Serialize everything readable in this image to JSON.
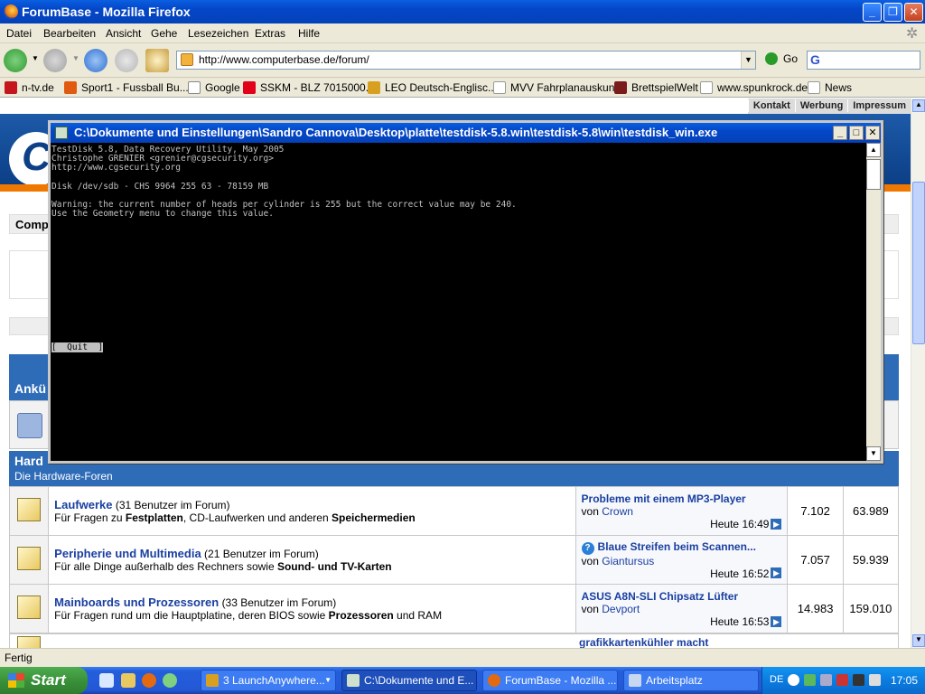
{
  "firefox": {
    "title": "ForumBase - Mozilla Firefox",
    "menu": [
      "Datei",
      "Bearbeiten",
      "Ansicht",
      "Gehe",
      "Lesezeichen",
      "Extras",
      "Hilfe"
    ],
    "url": "http://www.computerbase.de/forum/",
    "go_label": "Go",
    "bookmarks": [
      "n-tv.de",
      "Sport1 - Fussball Bu...",
      "Google",
      "SSKM - BLZ 7015000...",
      "LEO Deutsch-Englisc...",
      "MVV Fahrplanauskunft",
      "BrettspielWelt",
      "www.spunkrock.de",
      "News"
    ],
    "status": "Fertig"
  },
  "page": {
    "topnav": [
      "Kontakt",
      "Werbung",
      "Impressum"
    ],
    "comp_label": "Comp",
    "announce_section": "Ankü",
    "hardware_section": {
      "title": "Hard",
      "subtitle": "Die Hardware-Foren"
    },
    "forums": [
      {
        "name": "Laufwerke",
        "users": "(31 Benutzer im Forum)",
        "desc_prefix": "Für Fragen zu ",
        "desc_bold1": "Festplatten",
        "desc_mid": ", CD-Laufwerken und anderen ",
        "desc_bold2": "Speichermedien",
        "desc_suffix": "",
        "last_title": "Probleme mit einem MP3-Player",
        "last_by_label": "von",
        "last_by": "Crown",
        "last_date": "Heute",
        "last_time": "16:49",
        "threads": "7.102",
        "posts": "63.989"
      },
      {
        "name": "Peripherie und Multimedia",
        "users": "(21 Benutzer im Forum)",
        "desc_prefix": "Für alle Dinge außerhalb des Rechners sowie ",
        "desc_bold1": "Sound- und TV-Karten",
        "desc_mid": "",
        "desc_bold2": "",
        "desc_suffix": "",
        "last_title": "Blaue Streifen beim Scannen...",
        "last_by_label": "von",
        "last_by": "Giantursus",
        "last_date": "Heute",
        "last_time": "16:52",
        "threads": "7.057",
        "posts": "59.939"
      },
      {
        "name": "Mainboards und Prozessoren",
        "users": "(33 Benutzer im Forum)",
        "desc_prefix": "Für Fragen rund um die Hauptplatine, deren BIOS sowie ",
        "desc_bold1": "Prozessoren",
        "desc_mid": " und RAM",
        "desc_bold2": "",
        "desc_suffix": "",
        "last_title": "ASUS A8N-SLI Chipsatz Lüfter",
        "last_by_label": "von",
        "last_by": "Devport",
        "last_date": "Heute",
        "last_time": "16:53",
        "threads": "14.983",
        "posts": "159.010"
      }
    ],
    "partial_row_title": "grafikkartenkühler macht"
  },
  "console": {
    "title": "C:\\Dokumente und Einstellungen\\Sandro Cannova\\Desktop\\platte\\testdisk-5.8.win\\testdisk-5.8\\win\\testdisk_win.exe",
    "lines": [
      "TestDisk 5.8, Data Recovery Utility, May 2005",
      "Christophe GRENIER <grenier@cgsecurity.org>",
      "http://www.cgsecurity.org",
      "",
      "Disk /dev/sdb - CHS 9964 255 63 - 78159 MB",
      "",
      "Warning: the current number of heads per cylinder is 255 but the correct value may be 240.",
      "Use the Geometry menu to change this value."
    ],
    "quit_label": "[  Quit  ]"
  },
  "taskbar": {
    "start_label": "Start",
    "tasks": [
      "3 LaunchAnywhere...",
      "C:\\Dokumente und E...",
      "ForumBase - Mozilla ...",
      "Arbeitsplatz"
    ],
    "lang": "DE",
    "clock": "17:05"
  }
}
